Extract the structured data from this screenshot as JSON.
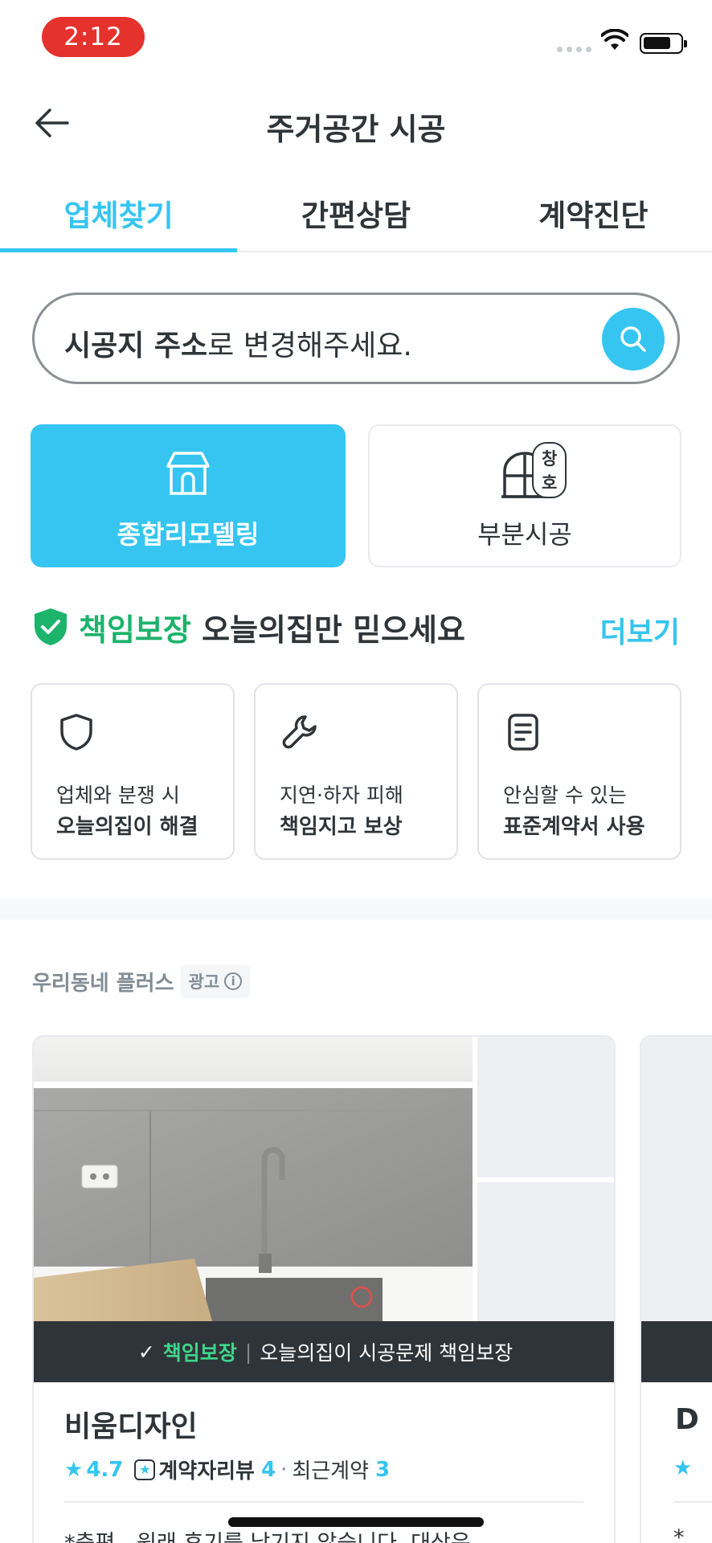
{
  "status_bar": {
    "time": "2:12"
  },
  "header": {
    "title": "주거공간 시공"
  },
  "tabs": [
    {
      "label": "업체찾기",
      "active": true
    },
    {
      "label": "간편상담",
      "active": false
    },
    {
      "label": "계약진단",
      "active": false
    }
  ],
  "search": {
    "bold_text": "시공지 주소",
    "rest_text": "로 변경해주세요."
  },
  "categories": [
    {
      "label": "종합리모델링",
      "icon": "house-icon",
      "selected": true
    },
    {
      "label": "부분시공",
      "icon": "window-icon",
      "badge": "창호",
      "selected": false
    }
  ],
  "guarantee": {
    "highlight": "책임보장",
    "title_rest": " 오늘의집만 믿으세요",
    "more": "더보기",
    "items": [
      {
        "icon": "shield-icon",
        "line1": "업체와 분쟁 시",
        "line2": "오늘의집이 해결"
      },
      {
        "icon": "wrench-icon",
        "line1": "지연·하자 피해",
        "line2": "책임지고 보상"
      },
      {
        "icon": "document-icon",
        "line1": "안심할 수 있는",
        "line2": "표준계약서 사용"
      }
    ]
  },
  "sponsored": {
    "label": "우리동네 플러스",
    "ad_badge": "광고"
  },
  "company": {
    "banner_highlight": "책임보장",
    "banner_text": "오늘의집이 시공문제 책임보장",
    "name": "비움디자인",
    "rating": "4.7",
    "review_label": "계약자리뷰",
    "review_count": "4",
    "recent_label": "최근계약",
    "recent_count": "3",
    "review_snippet": "*충편 - 원래 후기를 남기지 않습니다. 대상은"
  },
  "peek_company": {
    "name_initial": "D",
    "snippet_initial": "*"
  },
  "colors": {
    "accent": "#35c5f0",
    "green": "#1cb36b",
    "text": "#2f3438"
  }
}
